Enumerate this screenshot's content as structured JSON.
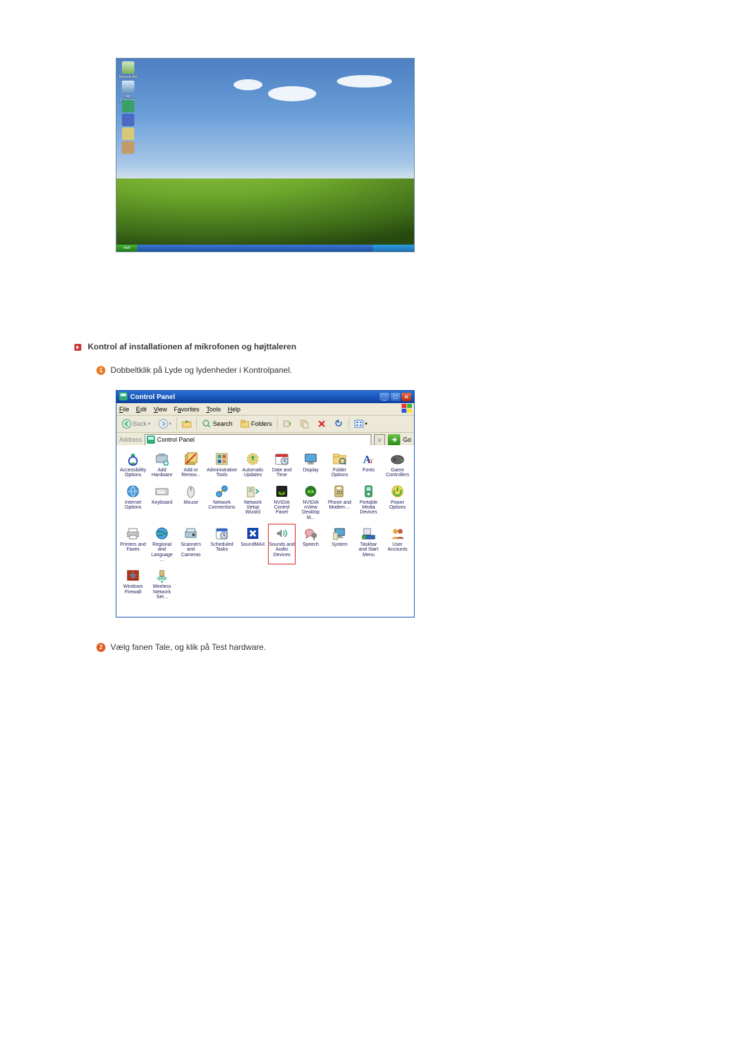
{
  "section_title": "Kontrol af installationen af mikrofonen og højttaleren",
  "step1": "Dobbeltklik på Lyde og lydenheder i Kontrolpanel.",
  "step2": "Vælg fanen Tale, og klik på Test hardware.",
  "desktop": {
    "start": "start",
    "icons": {
      "recycle": "Recycle Bin",
      "mycomp": "My Computer"
    }
  },
  "cp": {
    "title": "Control Panel",
    "menu": {
      "file": "File",
      "edit": "Edit",
      "view": "View",
      "fav": "Favorites",
      "tools": "Tools",
      "help": "Help"
    },
    "toolbar": {
      "back": "Back",
      "search": "Search",
      "folders": "Folders"
    },
    "address_label": "Address",
    "address_value": "Control Panel",
    "go": "Go",
    "items": [
      {
        "k": "access",
        "l": "Accessibility Options"
      },
      {
        "k": "addhw",
        "l": "Add Hardware"
      },
      {
        "k": "addrem",
        "l": "Add or Remov..."
      },
      {
        "k": "admin",
        "l": "Administrative Tools"
      },
      {
        "k": "auto",
        "l": "Automatic Updates"
      },
      {
        "k": "date",
        "l": "Date and Time"
      },
      {
        "k": "disp",
        "l": "Display"
      },
      {
        "k": "folder",
        "l": "Folder Options"
      },
      {
        "k": "fonts",
        "l": "Fonts"
      },
      {
        "k": "game",
        "l": "Game Controllers"
      },
      {
        "k": "inet",
        "l": "Internet Options"
      },
      {
        "k": "keyb",
        "l": "Keyboard"
      },
      {
        "k": "mouse",
        "l": "Mouse"
      },
      {
        "k": "netc",
        "l": "Network Connections"
      },
      {
        "k": "netsw",
        "l": "Network Setup Wizard"
      },
      {
        "k": "nvcp",
        "l": "NVIDIA Control Panel"
      },
      {
        "k": "nvd",
        "l": "NVIDIA nView Desktop M..."
      },
      {
        "k": "phone",
        "l": "Phone and Modem ..."
      },
      {
        "k": "pmd",
        "l": "Portable Media Devices"
      },
      {
        "k": "power",
        "l": "Power Options"
      },
      {
        "k": "print",
        "l": "Printers and Faxes"
      },
      {
        "k": "region",
        "l": "Regional and Language ..."
      },
      {
        "k": "scan",
        "l": "Scanners and Cameras"
      },
      {
        "k": "sched",
        "l": "Scheduled Tasks"
      },
      {
        "k": "smax",
        "l": "SoundMAX"
      },
      {
        "k": "sounds",
        "l": "Sounds and Audio Devices",
        "hl": true
      },
      {
        "k": "speech",
        "l": "Speech"
      },
      {
        "k": "system",
        "l": "System"
      },
      {
        "k": "taskbar",
        "l": "Taskbar and Start Menu"
      },
      {
        "k": "users",
        "l": "User Accounts"
      },
      {
        "k": "wfw",
        "l": "Windows Firewall"
      },
      {
        "k": "wnet",
        "l": "Wireless Network Set..."
      }
    ]
  }
}
